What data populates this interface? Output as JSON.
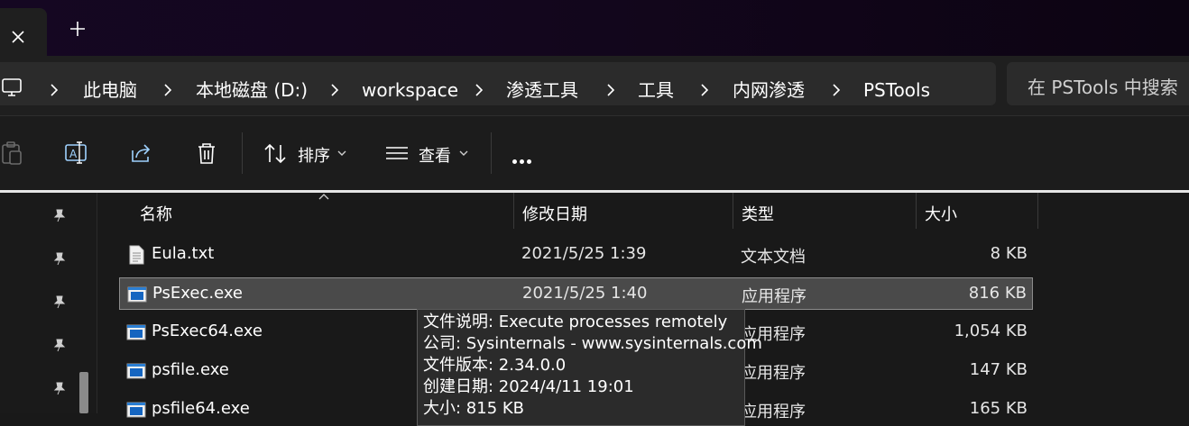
{
  "titlebar": {
    "close_tab_icon": "close-icon",
    "new_tab_icon": "plus-icon"
  },
  "address": {
    "computer_icon": "monitor-icon",
    "crumbs": [
      "此电脑",
      "本地磁盘 (D:)",
      "workspace",
      "渗透工具",
      "工具",
      "内网渗透",
      "PSTools"
    ],
    "search_placeholder": "在 PSTools 中搜索"
  },
  "commandbar": {
    "sort_label": "排序",
    "view_label": "查看",
    "icons": [
      "paste-icon",
      "rename-icon",
      "share-icon",
      "delete-icon",
      "sort-icon",
      "view-icon",
      "more-icon"
    ]
  },
  "columns": {
    "name": "名称",
    "modified": "修改日期",
    "type": "类型",
    "size": "大小"
  },
  "files": [
    {
      "name": "Eula.txt",
      "date": "2021/5/25 1:39",
      "type": "文本文档",
      "size": "8 KB",
      "icon": "text-file-icon",
      "selected": false
    },
    {
      "name": "PsExec.exe",
      "date": "2021/5/25 1:40",
      "type": "应用程序",
      "size": "816 KB",
      "icon": "exe-file-icon",
      "selected": true
    },
    {
      "name": "PsExec64.exe",
      "date": "",
      "type": "应用程序",
      "size": "1,054 KB",
      "icon": "exe-file-icon",
      "selected": false
    },
    {
      "name": "psfile.exe",
      "date": "",
      "type": "应用程序",
      "size": "147 KB",
      "icon": "exe-file-icon",
      "selected": false
    },
    {
      "name": "psfile64.exe",
      "date": "",
      "type": "应用程序",
      "size": "165 KB",
      "icon": "exe-file-icon",
      "selected": false
    }
  ],
  "tooltip": {
    "description": "文件说明: Execute processes remotely",
    "company": "公司: Sysinternals - www.sysinternals.com",
    "version": "文件版本: 2.34.0.0",
    "created": "创建日期: 2024/4/11 19:01",
    "size": "大小: 815 KB"
  },
  "colors": {
    "titlebar": "#150722",
    "background": "#191919",
    "selection": "#4a4a4a"
  }
}
